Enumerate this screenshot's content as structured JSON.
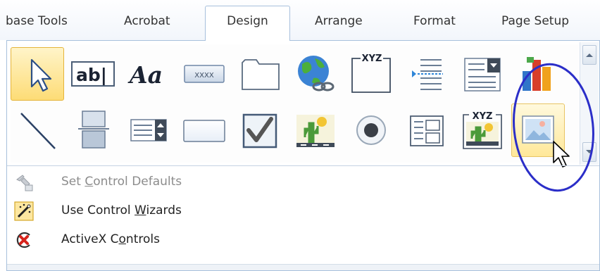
{
  "ribbon": {
    "tabs": [
      {
        "label": "base Tools"
      },
      {
        "label": "Acrobat"
      },
      {
        "label": "Design",
        "active": true
      },
      {
        "label": "Arrange"
      },
      {
        "label": "Format"
      },
      {
        "label": "Page Setup"
      }
    ]
  },
  "controls_gallery": {
    "row1": [
      {
        "icon": "select-arrow-icon",
        "state": "selected"
      },
      {
        "icon": "text-box-icon",
        "text": "ab|"
      },
      {
        "icon": "label-icon",
        "text": "Aa"
      },
      {
        "icon": "button-icon",
        "text": "XXXX"
      },
      {
        "icon": "tab-control-icon"
      },
      {
        "icon": "hyperlink-icon"
      },
      {
        "icon": "option-group-icon",
        "text": "XYZ"
      },
      {
        "icon": "insert-page-break-icon"
      },
      {
        "icon": "combo-box-icon"
      },
      {
        "icon": "chart-icon"
      }
    ],
    "row2": [
      {
        "icon": "line-icon"
      },
      {
        "icon": "toggle-button-icon"
      },
      {
        "icon": "list-box-icon"
      },
      {
        "icon": "rectangle-icon"
      },
      {
        "icon": "check-box-icon"
      },
      {
        "icon": "unbound-object-frame-icon"
      },
      {
        "icon": "option-button-icon"
      },
      {
        "icon": "subform-icon"
      },
      {
        "icon": "bound-object-frame-icon",
        "text": "XYZ"
      },
      {
        "icon": "image-icon",
        "state": "hovered"
      }
    ]
  },
  "menu": {
    "items": [
      {
        "label": "Set Control Defaults",
        "accel": "C",
        "icon": "control-defaults-icon",
        "enabled": false
      },
      {
        "label": "Use Control Wizards",
        "accel": "W",
        "icon": "magic-wand-icon",
        "enabled": true
      },
      {
        "label": "ActiveX Controls",
        "accel": "o",
        "icon": "activex-icon",
        "enabled": true
      }
    ]
  },
  "annotation": {
    "color": "#2b2ec8"
  }
}
